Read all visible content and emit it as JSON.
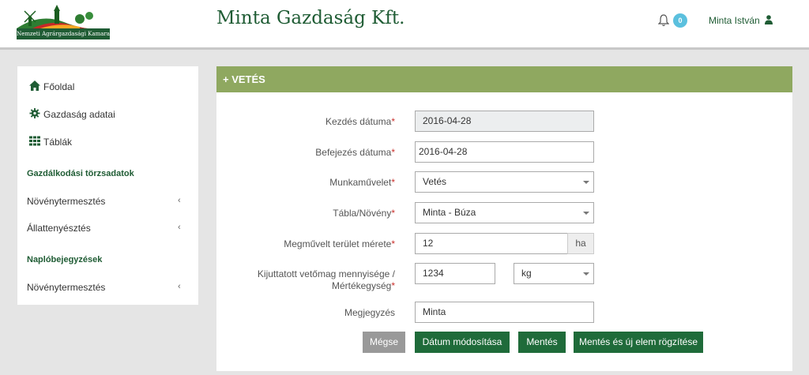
{
  "header": {
    "logo_text": "Nemzeti Agrárgazdasági Kamara",
    "site_title": "Minta Gazdaság Kft.",
    "notifications": "0",
    "user_name": "Minta István"
  },
  "sidebar": {
    "items": [
      {
        "label": "Főoldal",
        "icon": "home-icon"
      },
      {
        "label": "Gazdaság adatai",
        "icon": "gear-icon"
      },
      {
        "label": "Táblák",
        "icon": "grid-icon"
      }
    ],
    "section1": {
      "title": "Gazdálkodási törzsadatok",
      "items": [
        "Növénytermesztés",
        "Állattenyésztés"
      ]
    },
    "section2": {
      "title": "Naplóbejegyzések",
      "items": [
        "Növénytermesztés"
      ]
    },
    "chevron": "‹"
  },
  "form": {
    "title": "+ VETÉS",
    "required_mark": "*",
    "start_date": {
      "label": "Kezdés dátuma",
      "value": "2016-04-28"
    },
    "end_date": {
      "label": "Befejezés dátuma",
      "value": "2016-04-28"
    },
    "operation": {
      "label": "Munkaművelet",
      "value": "Vetés"
    },
    "table_crop": {
      "label": "Tábla/Növény",
      "value": "Minta - Búza"
    },
    "area": {
      "label": "Megművelt terület mérete",
      "value": "12",
      "unit": "ha"
    },
    "seed_qty": {
      "label_line1": "Kijuttatott vetőmag mennyisége /",
      "label_line2": "Mértékegység",
      "value": "1234",
      "unit": "kg"
    },
    "note": {
      "label": "Megjegyzés",
      "value": "Minta"
    }
  },
  "buttons": {
    "cancel": "Mégse",
    "change_date": "Dátum módosítása",
    "save": "Mentés",
    "save_new": "Mentés és új elem rögzítése"
  },
  "colors": {
    "brand_green": "#1f5c34",
    "panel_header": "#8fa860",
    "badge": "#5bc0de"
  }
}
